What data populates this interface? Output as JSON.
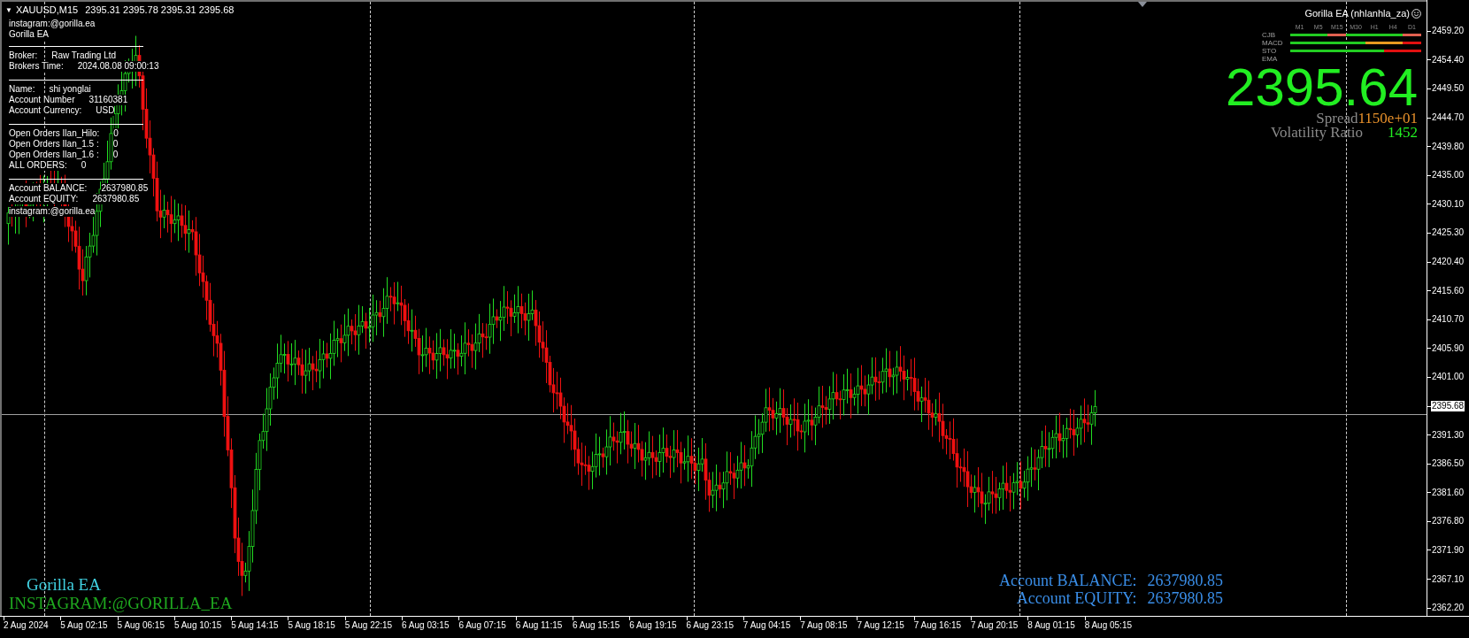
{
  "chart_header": {
    "arrow": "▼",
    "symbol": "XAUUSD,M15",
    "quotes": "2395.31 2395.78 2395.31 2395.68"
  },
  "info_panel": {
    "header": [
      "instagram:@gorilla.ea",
      "Gorilla EA"
    ],
    "sections": [
      [
        {
          "label": "Broker:",
          "value": "Raw Trading Ltd"
        },
        {
          "label": "Brokers Time:",
          "value": "2024.08.08 09:00:13"
        }
      ],
      [
        {
          "label": "Name:",
          "value": "shi yonglai"
        },
        {
          "label": "Account Number",
          "value": "31160381"
        },
        {
          "label": "Account Currency:",
          "value": "USD"
        }
      ],
      [
        {
          "label": "Open Orders Ilan_Hilo:",
          "value": "0"
        },
        {
          "label": "Open Orders Ilan_1.5 :",
          "value": "0"
        },
        {
          "label": "Open Orders Ilan_1.6 :",
          "value": "0"
        },
        {
          "label": "ALL ORDERS:",
          "value": "0"
        }
      ],
      [
        {
          "label": "Account BALANCE:",
          "value": "2637980.85"
        },
        {
          "label": "Account EQUITY:",
          "value": "2637980.85"
        }
      ]
    ],
    "footer": "instagram:@gorilla.ea"
  },
  "ea_panel": {
    "title": "Gorilla EA (nhlanhla_za)",
    "timeframes": [
      "M1",
      "M5",
      "M15",
      "M30",
      "H1",
      "H4",
      "D1"
    ],
    "indicators": [
      {
        "label": "CJB",
        "cells": [
          {
            "color": "#22cc22"
          },
          {
            "color": "#22cc22"
          },
          {
            "color": "#e06050"
          },
          {
            "color": "#22cc22"
          },
          {
            "color": "#22cc22"
          },
          {
            "color": "#22cc22"
          },
          {
            "color": "#e06050"
          }
        ]
      },
      {
        "label": "MACD",
        "cells": [
          {
            "color": "#22cc22"
          },
          {
            "color": "#22cc22"
          },
          {
            "color": "#22cc22"
          },
          {
            "color": "#22cc22"
          },
          {
            "color": "#e89a20"
          },
          {
            "color": "#e89a20"
          },
          {
            "color": "#e01010"
          }
        ]
      },
      {
        "label": "STO",
        "cells": [
          {
            "color": "#22cc22"
          },
          {
            "color": "#22cc22"
          },
          {
            "color": "#22cc22"
          },
          {
            "color": "#22cc22"
          },
          {
            "color": "#22cc22"
          },
          {
            "color": "#e01010"
          },
          {
            "color": "#e01010"
          }
        ]
      },
      {
        "label": "EMA"
      }
    ],
    "price": "2395.64",
    "spread_label": "Spread",
    "spread_value": "1150e+01",
    "volatility_label": "Volatility Ratio",
    "volatility_value": "1452"
  },
  "bottom_left": {
    "name": "Gorilla EA",
    "instagram": "INSTAGRAM:@GORILLA_EA"
  },
  "account_summary": [
    {
      "label": "Account BALANCE:",
      "value": "2637980.85"
    },
    {
      "label": "Account EQUITY:",
      "value": "2637980.85"
    }
  ],
  "price_axis": [
    {
      "label": "2459.20",
      "kind": "tick"
    },
    {
      "label": "2454.40",
      "kind": "tick"
    },
    {
      "label": "2449.50",
      "kind": "tick"
    },
    {
      "label": "2444.70",
      "kind": "tick"
    },
    {
      "label": "2439.80",
      "kind": "tick"
    },
    {
      "label": "2435.00",
      "kind": "tick"
    },
    {
      "label": "2430.10",
      "kind": "tick"
    },
    {
      "label": "2425.30",
      "kind": "tick"
    },
    {
      "label": "2420.40",
      "kind": "tick"
    },
    {
      "label": "2415.60",
      "kind": "tick"
    },
    {
      "label": "2410.70",
      "kind": "tick"
    },
    {
      "label": "2405.90",
      "kind": "tick"
    },
    {
      "label": "2401.00",
      "kind": "tick"
    },
    {
      "label": "2395.68",
      "kind": "current"
    },
    {
      "label": "2391.30",
      "kind": "tick"
    },
    {
      "label": "2386.50",
      "kind": "tick"
    },
    {
      "label": "2381.60",
      "kind": "tick"
    },
    {
      "label": "2376.80",
      "kind": "tick"
    },
    {
      "label": "2371.90",
      "kind": "tick"
    },
    {
      "label": "2367.10",
      "kind": "tick"
    },
    {
      "label": "2362.20",
      "kind": "tick"
    }
  ],
  "time_axis": [
    "2 Aug 2024",
    "5 Aug 02:15",
    "5 Aug 06:15",
    "5 Aug 10:15",
    "5 Aug 14:15",
    "5 Aug 18:15",
    "5 Aug 22:15",
    "6 Aug 03:15",
    "6 Aug 07:15",
    "6 Aug 11:15",
    "6 Aug 15:15",
    "6 Aug 19:15",
    "6 Aug 23:15",
    "7 Aug 04:15",
    "7 Aug 08:15",
    "7 Aug 12:15",
    "7 Aug 16:15",
    "7 Aug 20:15",
    "8 Aug 01:15",
    "8 Aug 05:15"
  ]
}
